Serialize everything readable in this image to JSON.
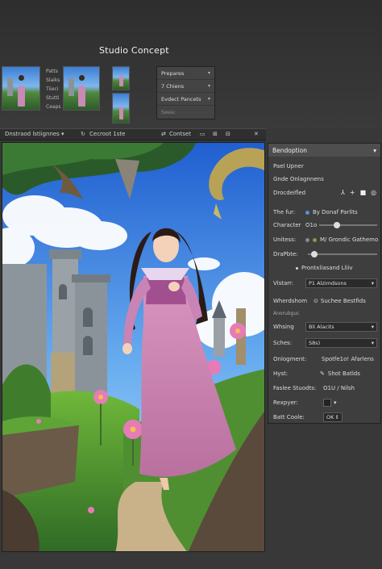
{
  "header": {
    "title": "Studio Concept"
  },
  "thumbnails": {
    "labels": [
      "Patts",
      "Slaiks",
      "Tiieci",
      "Stutti",
      "Ceaps"
    ]
  },
  "mini_panel": {
    "rows": [
      {
        "label": "Prepares",
        "caret": "▾"
      },
      {
        "label": "7 Chiens",
        "caret": "▾"
      },
      {
        "label": "Evdect Pancets",
        "caret": "▾"
      },
      {
        "label": "Seee:",
        "caret": ""
      }
    ]
  },
  "toolbar": {
    "left_label": "Dnstraod lstiignnes",
    "left_caret": "▾",
    "tab_label": "Cecroot 1ste",
    "tab_icon": "↻",
    "right_label": "Contset",
    "right_icon": "⇄"
  },
  "panel": {
    "title": "Bendoption",
    "title_caret": "▾",
    "rows": {
      "r1": "Pael Upner",
      "r2": "Gnde Onlagnnens",
      "r3": {
        "label": "Drocdeifled"
      },
      "r4": {
        "label": "The fur:",
        "value": "By Donaf Parlits",
        "dot_color": "#5a8fd8"
      },
      "r5": {
        "label": "Character",
        "value": "O1o"
      },
      "r6": {
        "label": "Unitess:",
        "value": "M/ Grondic Gathemo",
        "dot_color": "#888888",
        "dot2_color": "#9a8f3a"
      },
      "r7": {
        "label": "DraPbte:"
      },
      "r8": {
        "label": "Prontxliasand Lliiv"
      },
      "r9": {
        "label": "Vistarr:",
        "value": "P1 Alzimdsons",
        "caret": "▾"
      },
      "r10": {
        "label": "Wherdshom",
        "value": "Suchee Bestfids"
      },
      "r11": "Anorubguc",
      "r12": {
        "label": "Whsing",
        "value": "Bli Alacits",
        "caret": "▾"
      },
      "r13": {
        "label": "Sches:",
        "value": "S8s)",
        "caret": "▾"
      },
      "r14": {
        "label": "Onlogment:",
        "value": "Spotfe1o! Afarlens"
      },
      "r15": {
        "label": "Hyst:",
        "value": "Shot Batlds"
      },
      "r16": {
        "label": "Faslee Stuodts:",
        "value": "O1U / Nilsh"
      },
      "r17": {
        "label": "Rexpyer:",
        "caret": "▾"
      },
      "r18": {
        "label": "Batt Coole:",
        "value": "OK",
        "caret": "⇕"
      }
    }
  }
}
